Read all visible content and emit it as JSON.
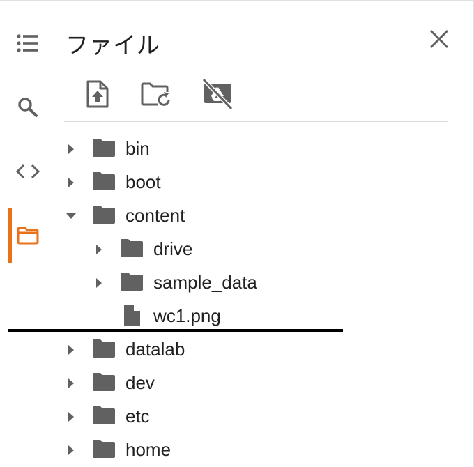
{
  "panel": {
    "title": "ファイル"
  },
  "rail": {
    "items": [
      {
        "name": "toc",
        "icon": "list-icon"
      },
      {
        "name": "search",
        "icon": "search-icon"
      },
      {
        "name": "code-snippets",
        "icon": "code-icon"
      },
      {
        "name": "files",
        "icon": "folder-outline-icon",
        "active": true
      }
    ]
  },
  "toolbar": {
    "buttons": [
      {
        "name": "upload",
        "icon": "file-upload-icon"
      },
      {
        "name": "refresh",
        "icon": "folder-refresh-icon"
      },
      {
        "name": "mount-drive",
        "icon": "drive-off-icon"
      }
    ]
  },
  "tree": [
    {
      "label": "bin",
      "type": "folder",
      "depth": 0,
      "expanded": false
    },
    {
      "label": "boot",
      "type": "folder",
      "depth": 0,
      "expanded": false
    },
    {
      "label": "content",
      "type": "folder",
      "depth": 0,
      "expanded": true
    },
    {
      "label": "drive",
      "type": "folder",
      "depth": 1,
      "expanded": false
    },
    {
      "label": "sample_data",
      "type": "folder",
      "depth": 1,
      "expanded": false
    },
    {
      "label": "wc1.png",
      "type": "file",
      "depth": 1
    },
    {
      "label": "datalab",
      "type": "folder",
      "depth": 0,
      "expanded": false
    },
    {
      "label": "dev",
      "type": "folder",
      "depth": 0,
      "expanded": false
    },
    {
      "label": "etc",
      "type": "folder",
      "depth": 0,
      "expanded": false
    },
    {
      "label": "home",
      "type": "folder",
      "depth": 0,
      "expanded": false
    }
  ],
  "colors": {
    "accent": "#e8711a",
    "icon": "#616161",
    "text": "#212121",
    "divider": "#dadada"
  }
}
